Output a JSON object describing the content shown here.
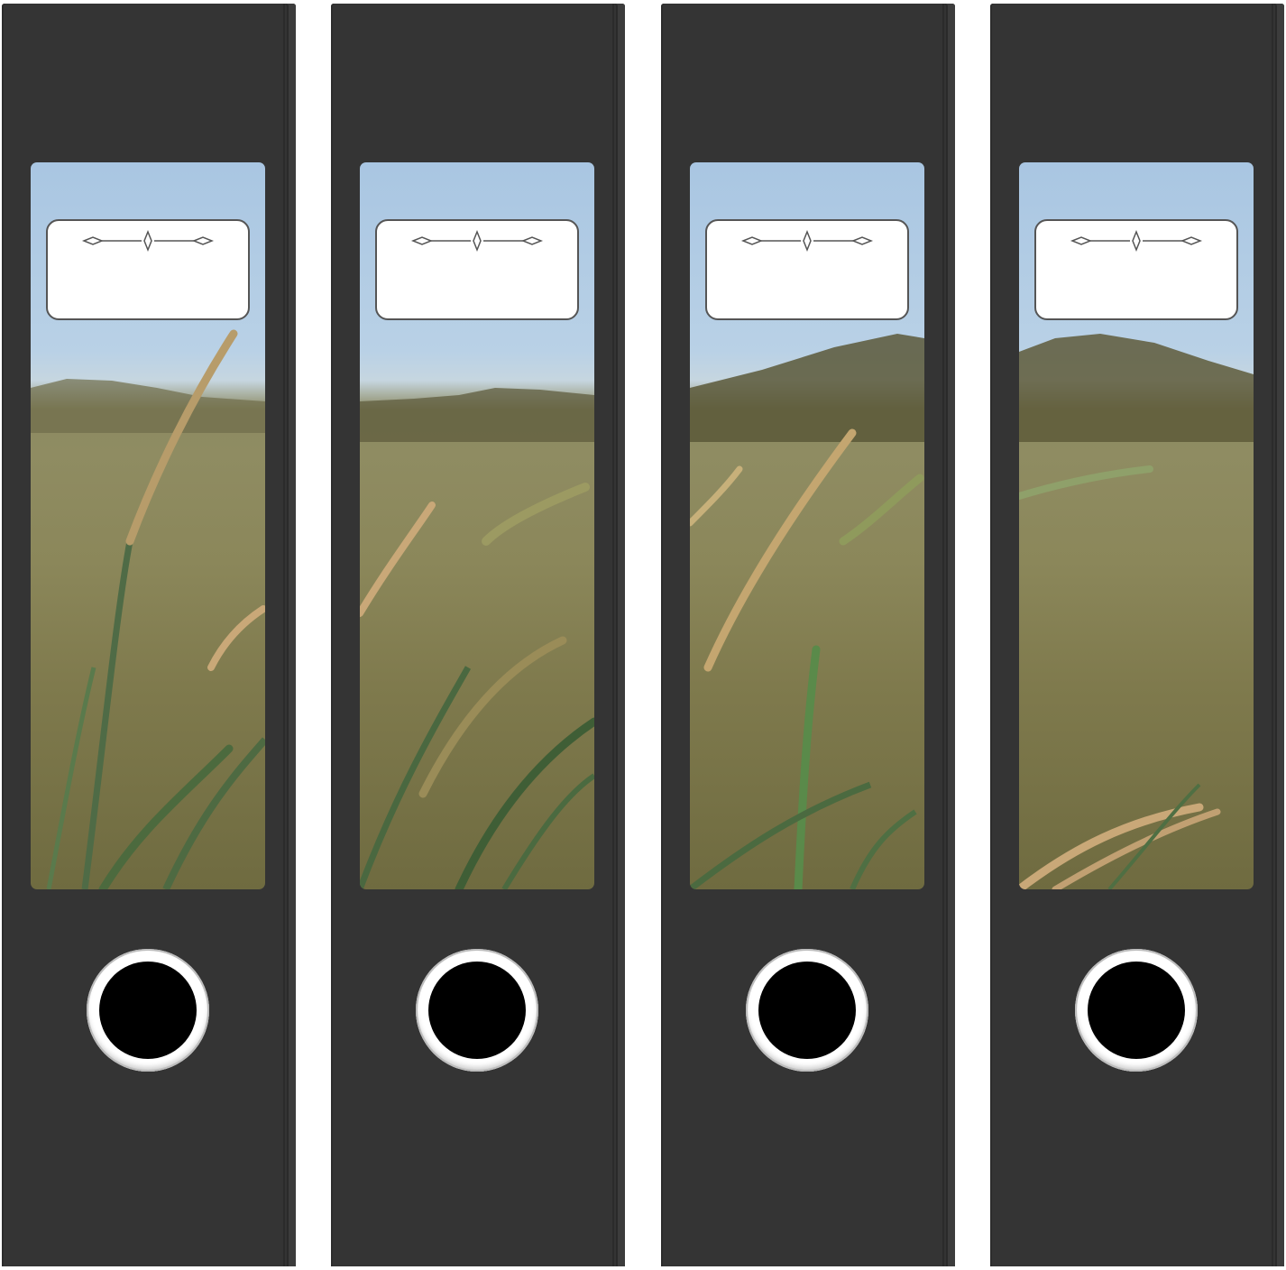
{
  "colors": {
    "spine": "#343434",
    "ring": "#ffffff",
    "hole": "#000000",
    "label_box": "#ffffff",
    "label_outline": "#555555",
    "sky": "#b9d1e6",
    "grass": "#8b875a"
  },
  "spines": [
    {
      "photo": "beach-grass-photo",
      "label_text": ""
    },
    {
      "photo": "beach-grass-photo",
      "label_text": ""
    },
    {
      "photo": "beach-grass-photo",
      "label_text": ""
    },
    {
      "photo": "beach-grass-photo",
      "label_text": ""
    }
  ],
  "icons": {
    "label_ornament": "flourish-divider-icon",
    "finger_hole": "finger-ring-icon"
  }
}
